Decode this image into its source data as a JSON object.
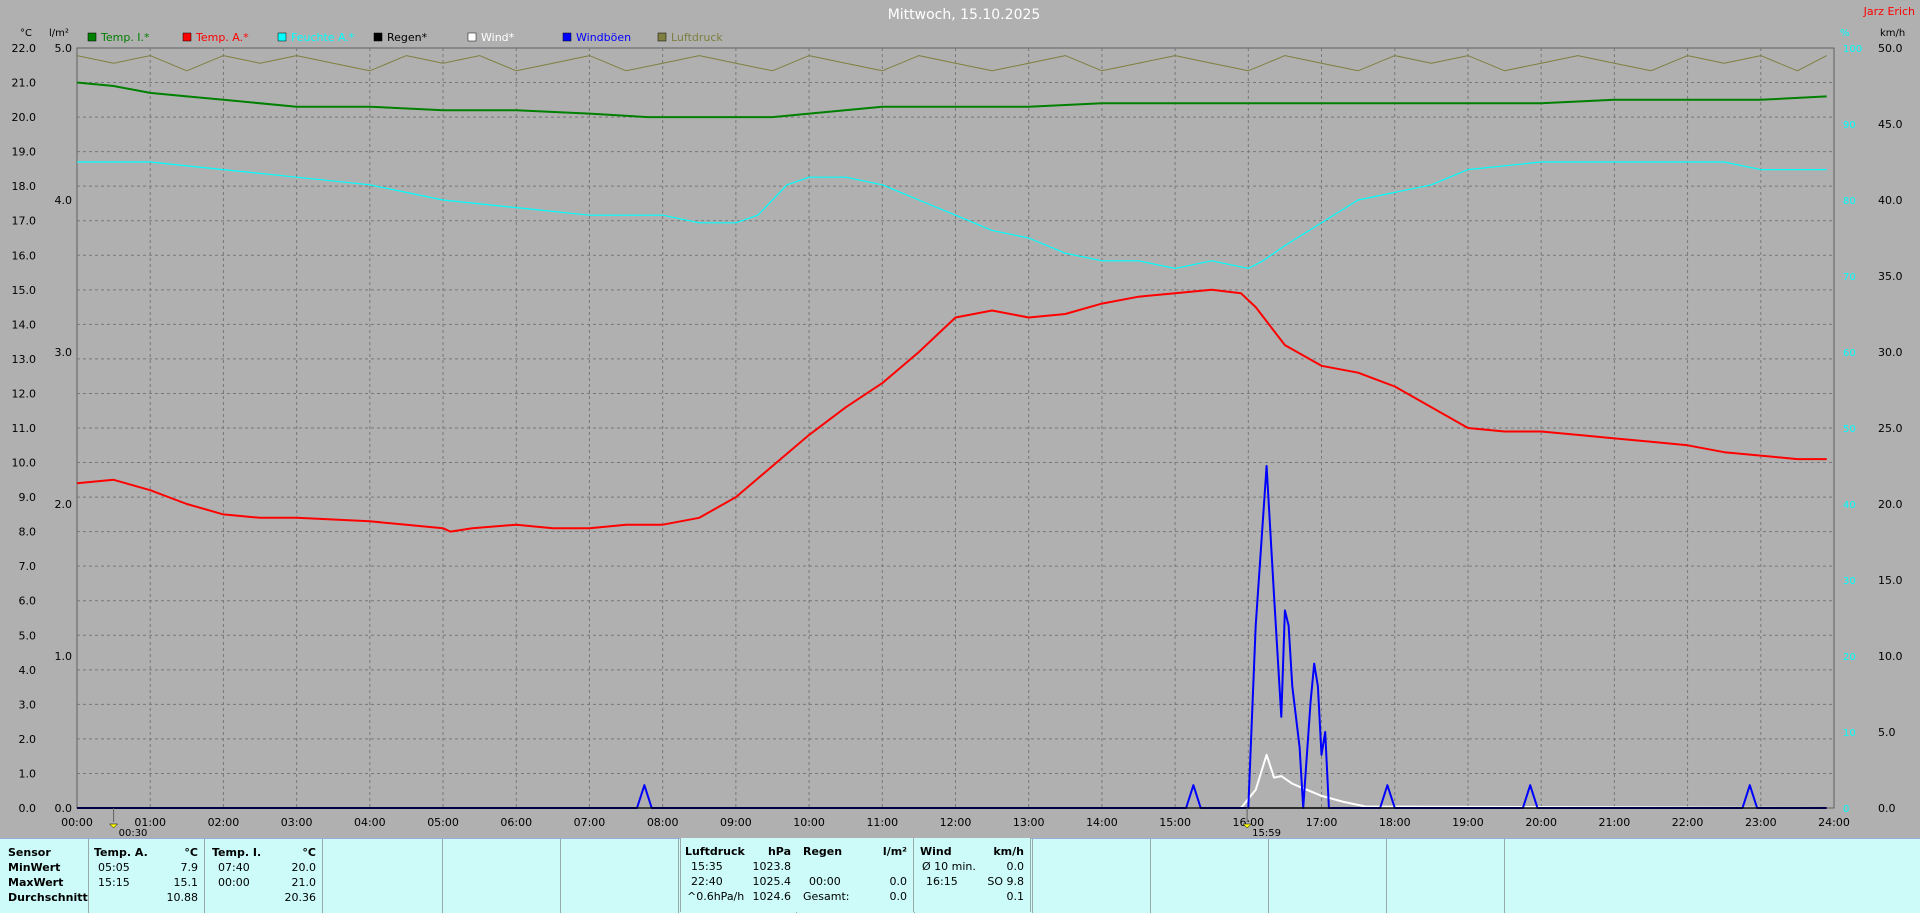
{
  "title": "Mittwoch, 15.10.2025",
  "author": "Jarz Erich",
  "units": {
    "left1": "°C",
    "left2": "l/m²",
    "right1": "%",
    "right2": "km/h"
  },
  "legend": [
    {
      "label": "Temp. I.*",
      "color": "#008000"
    },
    {
      "label": "Temp. A.*",
      "color": "#ff0000"
    },
    {
      "label": "Feuchte A.*",
      "color": "#00ffff"
    },
    {
      "label": "Regen*",
      "color": "#000000"
    },
    {
      "label": "Wind*",
      "color": "#ffffff"
    },
    {
      "label": "Windböen",
      "color": "#0000ff"
    },
    {
      "label": "Luftdruck",
      "color": "#7f7f40"
    }
  ],
  "markers": [
    {
      "time": "00:30"
    },
    {
      "time": "15:59"
    }
  ],
  "chart_data": {
    "type": "line",
    "x_unit": "hour",
    "xlim": [
      0,
      24
    ],
    "x_ticks": [
      "00:00",
      "01:00",
      "02:00",
      "03:00",
      "04:00",
      "05:00",
      "06:00",
      "07:00",
      "08:00",
      "09:00",
      "10:00",
      "11:00",
      "12:00",
      "13:00",
      "14:00",
      "15:00",
      "16:00",
      "17:00",
      "18:00",
      "19:00",
      "20:00",
      "21:00",
      "22:00",
      "23:00",
      "24:00"
    ],
    "y_temp": {
      "lim": [
        0,
        22
      ],
      "ticks": [
        "0.0",
        "1.0",
        "2.0",
        "3.0",
        "4.0",
        "5.0",
        "6.0",
        "7.0",
        "8.0",
        "9.0",
        "10.0",
        "11.0",
        "12.0",
        "13.0",
        "14.0",
        "15.0",
        "16.0",
        "17.0",
        "18.0",
        "19.0",
        "20.0",
        "21.0",
        "22.0"
      ]
    },
    "y_rain": {
      "lim": [
        0,
        5
      ],
      "ticks": [
        "0.0",
        "1.0",
        "2.0",
        "3.0",
        "4.0",
        "5.0"
      ]
    },
    "y_hum": {
      "lim": [
        0,
        100
      ],
      "ticks": [
        "0",
        "10",
        "20",
        "30",
        "40",
        "50",
        "60",
        "70",
        "80",
        "90",
        "100"
      ]
    },
    "y_wind": {
      "lim": [
        0,
        50
      ],
      "ticks": [
        "0.0",
        "5.0",
        "10.0",
        "15.0",
        "20.0",
        "25.0",
        "30.0",
        "35.0",
        "40.0",
        "45.0",
        "50.0"
      ]
    },
    "series": [
      {
        "name": "Temp. I.*",
        "color": "#008000",
        "axis": "temp",
        "x": [
          0,
          0.5,
          1,
          1.5,
          2,
          3,
          4,
          5,
          6,
          7,
          7.8,
          8.5,
          9.5,
          10,
          11,
          12,
          13,
          14,
          15,
          16,
          17,
          18,
          19,
          20,
          21,
          22,
          23,
          23.9
        ],
        "y": [
          21.0,
          20.9,
          20.7,
          20.6,
          20.5,
          20.3,
          20.3,
          20.2,
          20.2,
          20.1,
          20.0,
          20.0,
          20.0,
          20.1,
          20.3,
          20.3,
          20.3,
          20.4,
          20.4,
          20.4,
          20.4,
          20.4,
          20.4,
          20.4,
          20.5,
          20.5,
          20.5,
          20.6
        ]
      },
      {
        "name": "Temp. A.*",
        "color": "#ff0000",
        "axis": "temp",
        "x": [
          0,
          0.5,
          1,
          1.5,
          2,
          2.5,
          3,
          4,
          4.5,
          5,
          5.1,
          5.4,
          6,
          6.5,
          7,
          7.5,
          8,
          8.5,
          9,
          9.5,
          10,
          10.5,
          11,
          11.5,
          12,
          12.5,
          13,
          13.5,
          14,
          14.5,
          15,
          15.5,
          15.9,
          16.1,
          16.5,
          17,
          17.5,
          18,
          18.5,
          19,
          19.5,
          20,
          20.5,
          21,
          21.5,
          22,
          22.5,
          23,
          23.5,
          23.9
        ],
        "y": [
          9.4,
          9.5,
          9.2,
          8.8,
          8.5,
          8.4,
          8.4,
          8.3,
          8.2,
          8.1,
          8.0,
          8.1,
          8.2,
          8.1,
          8.1,
          8.2,
          8.2,
          8.4,
          9.0,
          9.9,
          10.8,
          11.6,
          12.3,
          13.2,
          14.2,
          14.4,
          14.2,
          14.3,
          14.6,
          14.8,
          14.9,
          15.0,
          14.9,
          14.5,
          13.4,
          12.8,
          12.6,
          12.2,
          11.6,
          11.0,
          10.9,
          10.9,
          10.8,
          10.7,
          10.6,
          10.5,
          10.3,
          10.2,
          10.1,
          10.1
        ]
      },
      {
        "name": "Feuchte A.*",
        "color": "#00ffff",
        "axis": "hum",
        "x": [
          0,
          1,
          2,
          3,
          4,
          5,
          6,
          7,
          8,
          8.5,
          9,
          9.3,
          9.7,
          10,
          10.5,
          11,
          11.5,
          12,
          12.5,
          13,
          13.5,
          14,
          14.5,
          15,
          15.5,
          16,
          16.2,
          16.5,
          17,
          17.5,
          18,
          18.5,
          19,
          20,
          21,
          22,
          22.5,
          23,
          23.9
        ],
        "y": [
          85,
          85,
          84,
          83,
          82,
          80,
          79,
          78,
          78,
          77,
          77,
          78,
          82,
          83,
          83,
          82,
          80,
          78,
          76,
          75,
          73,
          72,
          72,
          71,
          72,
          71,
          72,
          74,
          77,
          80,
          81,
          82,
          84,
          85,
          85,
          85,
          85,
          84,
          84
        ]
      },
      {
        "name": "Luftdruck",
        "color": "#7f7f40",
        "axis": "hum",
        "x": [
          0,
          0.5,
          1,
          1.5,
          2,
          2.5,
          3,
          3.5,
          4,
          4.5,
          5,
          5.5,
          6,
          6.5,
          7,
          7.5,
          8,
          8.5,
          9,
          9.5,
          10,
          10.5,
          11,
          11.5,
          12,
          12.5,
          13,
          13.5,
          14,
          14.5,
          15,
          15.5,
          16,
          16.5,
          17,
          17.5,
          18,
          18.5,
          19,
          19.5,
          20,
          20.5,
          21,
          21.5,
          22,
          22.5,
          23,
          23.5,
          23.9
        ],
        "y": [
          99,
          98,
          99,
          97,
          99,
          98,
          99,
          98,
          97,
          99,
          98,
          99,
          97,
          98,
          99,
          97,
          98,
          99,
          98,
          97,
          99,
          98,
          97,
          99,
          98,
          97,
          98,
          99,
          97,
          98,
          99,
          98,
          97,
          99,
          98,
          97,
          99,
          98,
          99,
          97,
          98,
          99,
          98,
          97,
          99,
          98,
          99,
          97,
          99
        ]
      },
      {
        "name": "Wind*",
        "color": "#ffffff",
        "axis": "wind",
        "x": [
          0,
          15.9,
          16.1,
          16.25,
          16.35,
          16.45,
          16.6,
          16.8,
          17.0,
          17.3,
          17.6,
          23.9
        ],
        "y": [
          0,
          0,
          1.2,
          3.5,
          2.0,
          2.1,
          1.6,
          1.2,
          0.8,
          0.4,
          0.1,
          0
        ]
      },
      {
        "name": "Windböen",
        "color": "#0000ff",
        "axis": "wind",
        "x": [
          0,
          7.65,
          7.75,
          7.85,
          15.15,
          15.25,
          15.35,
          16.0,
          16.1,
          16.25,
          16.35,
          16.45,
          16.5,
          16.55,
          16.6,
          16.7,
          16.75,
          16.85,
          16.9,
          16.95,
          17.0,
          17.05,
          17.1,
          17.3,
          17.8,
          17.9,
          18.0,
          19.75,
          19.85,
          19.95,
          22.75,
          22.85,
          22.95,
          23.9
        ],
        "y": [
          0,
          0,
          1.5,
          0,
          0,
          1.5,
          0,
          0,
          12,
          22.5,
          14,
          6,
          13,
          12,
          8,
          4,
          0,
          7,
          9.5,
          8,
          3.5,
          5,
          0,
          0,
          0,
          1.5,
          0,
          0,
          1.5,
          0,
          0,
          1.5,
          0,
          0
        ]
      },
      {
        "name": "Regen*",
        "color": "#000000",
        "axis": "rain",
        "x": [
          0,
          23.9
        ],
        "y": [
          0,
          0
        ]
      }
    ]
  },
  "stats": {
    "sensor": {
      "header": "Sensor",
      "rows": [
        "MinWert",
        "MaxWert",
        "Durchschnitt"
      ]
    },
    "temp_a": {
      "header": "Temp. A.",
      "unit": "°C",
      "rows": [
        [
          "05:05",
          "7.9"
        ],
        [
          "15:15",
          "15.1"
        ],
        [
          "",
          "10.88"
        ]
      ]
    },
    "temp_i": {
      "header": "Temp. I.",
      "unit": "°C",
      "rows": [
        [
          "07:40",
          "20.0"
        ],
        [
          "00:00",
          "21.0"
        ],
        [
          "",
          "20.36"
        ]
      ]
    },
    "pressure": {
      "header": "Luftdruck",
      "unit": "hPa",
      "rows": [
        [
          "15:35",
          "1023.8"
        ],
        [
          "22:40",
          "1025.4"
        ],
        [
          "^0.6hPa/h",
          "1024.6"
        ]
      ]
    },
    "rain": {
      "header": "Regen",
      "unit": "l/m²",
      "rows": [
        [
          "",
          ""
        ],
        [
          "00:00",
          "0.0"
        ],
        [
          "Gesamt:",
          "0.0"
        ]
      ]
    },
    "wind": {
      "header": "Wind",
      "unit": "km/h",
      "rows": [
        [
          "Ø 10 min.",
          "0.0"
        ],
        [
          "16:15",
          "SO 9.8"
        ],
        [
          "",
          "0.1"
        ]
      ]
    }
  }
}
